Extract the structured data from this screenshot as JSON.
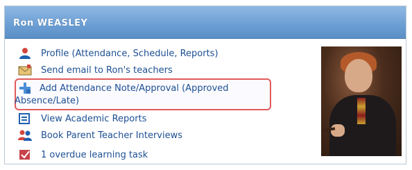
{
  "header": {
    "title": "Ron WEASLEY"
  },
  "menu": {
    "items": [
      {
        "label": "Profile (Attendance, Schedule, Reports)",
        "icon": "person-icon"
      },
      {
        "label": "Send email to Ron's teachers",
        "icon": "email-icon"
      },
      {
        "label_line1": "Add Attendance Note/Approval (Approved",
        "label_line2": "Absence/Late)",
        "icon": "add-note-icon"
      },
      {
        "label": "View Academic Reports",
        "icon": "report-icon"
      },
      {
        "label": "Book Parent Teacher Interviews",
        "icon": "people-icon"
      },
      {
        "label": "1 overdue learning task",
        "icon": "task-icon"
      }
    ]
  },
  "photo": {
    "icon": "student-photo"
  },
  "colors": {
    "header": "#6b9ed3",
    "link": "#1c4f93",
    "highlight_border": "#e15a5a"
  }
}
